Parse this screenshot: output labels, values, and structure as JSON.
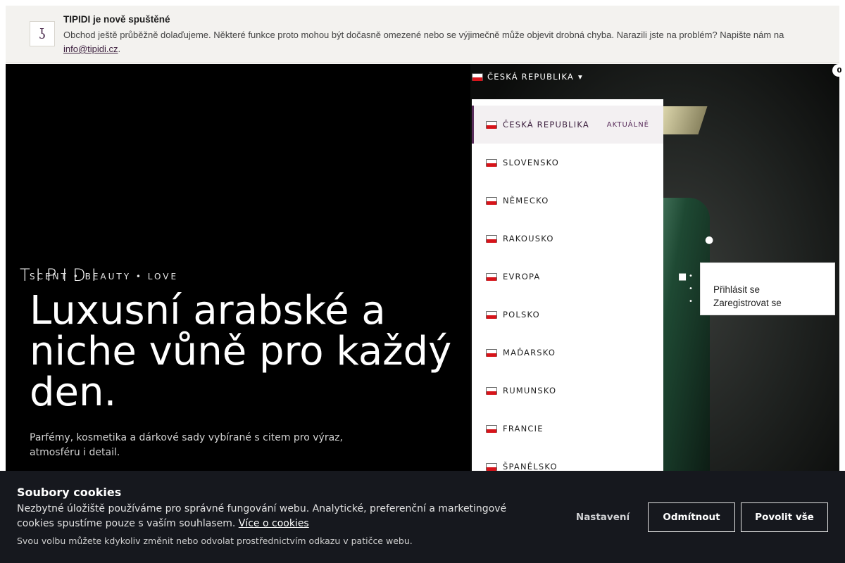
{
  "notice": {
    "icon": "info-glyph",
    "icon_glyph": "ʖ",
    "title": "TIPIDI je nově spuštěné",
    "text": "Obchod ještě průběžně dolaďujeme. Některé funkce proto mohou být dočasně omezené nebo se výjimečně může objevit drobná chyba. Narazili jste na problém? Napište nám na ",
    "email": "info@tipidi.cz",
    "text_end": "."
  },
  "hero": {
    "brand": "TIPIDI",
    "tagline": "SCENT • BEAUTY • LOVE",
    "title": "Luxusní arabské a niche vůně pro každý den.",
    "subtitle": "Parfémy, kosmetika a dárkové sady vybírané s citem pro výraz, atmosféru i detail."
  },
  "country_selector": {
    "label": "ČESKÁ REPUBLIKA",
    "chevron": "▾",
    "current_label": "AKTUÁLNĚ",
    "items": [
      {
        "name": "ČESKÁ REPUBLIKA"
      },
      {
        "name": "SLOVENSKO"
      },
      {
        "name": "NĚMECKO"
      },
      {
        "name": "RAKOUSKO"
      },
      {
        "name": "EVROPA"
      },
      {
        "name": "POLSKO"
      },
      {
        "name": "MAĎARSKO"
      },
      {
        "name": "RUMUNSKO"
      },
      {
        "name": "FRANCIE"
      },
      {
        "name": "ŠPANĚLSKO"
      }
    ]
  },
  "header": {
    "cart_count": "0",
    "user_icon": "user-icon",
    "cart_icon": "cart-icon"
  },
  "account_menu": {
    "login": "Přihlásit se",
    "register": "Zaregistrovat se"
  },
  "cookies": {
    "title": "Soubory cookies",
    "text": "Nezbytné úložiště používáme pro správné fungování webu. Analytické, preferenční a marketingové cookies spustíme pouze s vaším souhlasem. ",
    "more_link": "Více o cookies",
    "note": "Svou volbu můžete kdykoliv změnit nebo odvolat prostřednictvím odkazu v patičce webu.",
    "settings": "Nastavení",
    "reject": "Odmítnout",
    "accept": "Povolit vše"
  }
}
